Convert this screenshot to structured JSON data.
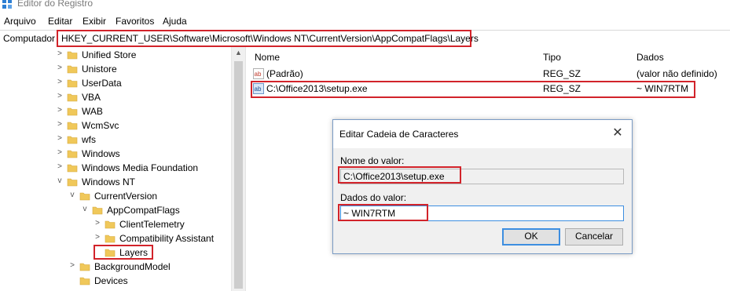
{
  "window": {
    "title": "Editor do Registro"
  },
  "menu": [
    "Arquivo",
    "Editar",
    "Exibir",
    "Favoritos",
    "Ajuda"
  ],
  "address": {
    "prefix": "Computador",
    "path": "HKEY_CURRENT_USER\\Software\\Microsoft\\Windows NT\\CurrentVersion\\AppCompatFlags\\Layers"
  },
  "tree": [
    {
      "label": "Unified Store",
      "arrow": ">"
    },
    {
      "label": "Unistore",
      "arrow": ">"
    },
    {
      "label": "UserData",
      "arrow": ">"
    },
    {
      "label": "VBA",
      "arrow": ">"
    },
    {
      "label": "WAB",
      "arrow": ">"
    },
    {
      "label": "WcmSvc",
      "arrow": ">"
    },
    {
      "label": "wfs",
      "arrow": ">"
    },
    {
      "label": "Windows",
      "arrow": ">"
    },
    {
      "label": "Windows Media Foundation",
      "arrow": ">"
    },
    {
      "label": "Windows NT",
      "arrow": "v"
    },
    {
      "label": "CurrentVersion",
      "arrow": "v"
    },
    {
      "label": "AppCompatFlags",
      "arrow": "v"
    },
    {
      "label": "ClientTelemetry",
      "arrow": ">"
    },
    {
      "label": "Compatibility Assistant",
      "arrow": ">"
    },
    {
      "label": "Layers",
      "arrow": ""
    },
    {
      "label": "BackgroundModel",
      "arrow": ">"
    },
    {
      "label": "Devices",
      "arrow": ""
    }
  ],
  "list": {
    "columns": [
      "Nome",
      "Tipo",
      "Dados"
    ],
    "rows": [
      {
        "name": "(Padrão)",
        "type": "REG_SZ",
        "data": "(valor não definido)"
      },
      {
        "name": "C:\\Office2013\\setup.exe",
        "type": "REG_SZ",
        "data": "~ WIN7RTM"
      }
    ]
  },
  "dialog": {
    "title": "Editar Cadeia de Caracteres",
    "name_label": "Nome do valor:",
    "name_value": "C:\\Office2013\\setup.exe",
    "data_label": "Dados do valor:",
    "data_value": "~ WIN7RTM",
    "ok": "OK",
    "cancel": "Cancelar",
    "close": "✕"
  },
  "colors": {
    "highlight": "#d2232a",
    "folder": "#f0c85a",
    "focus": "#3d8ee0"
  }
}
